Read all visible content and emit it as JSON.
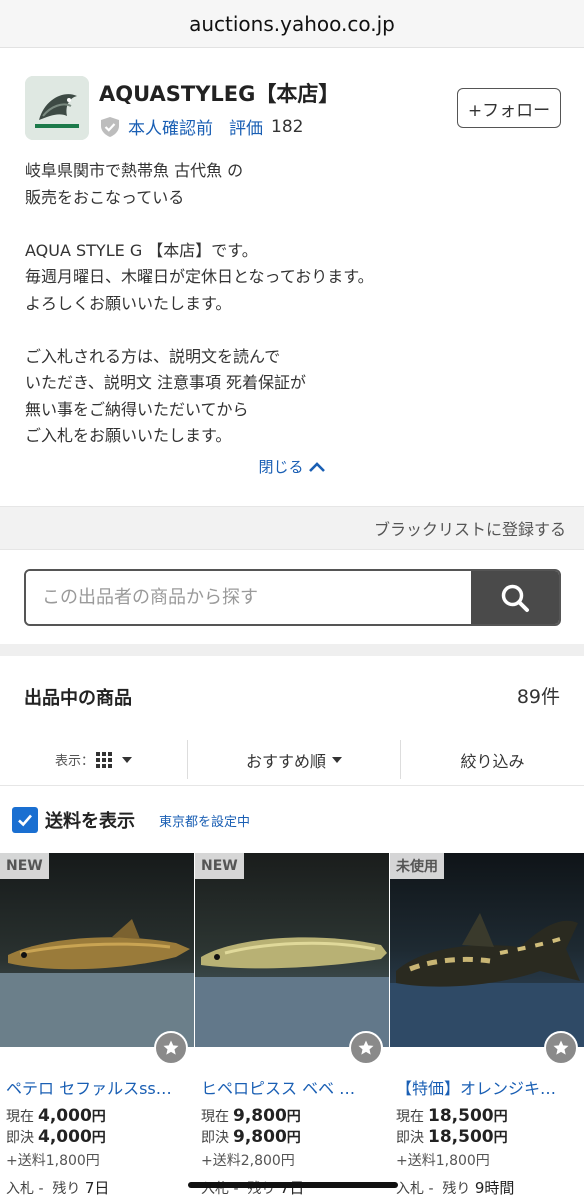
{
  "browser": {
    "url": "auctions.yahoo.co.jp"
  },
  "seller": {
    "name": "AQUASTYLEG【本店】",
    "verified": "本人確認前",
    "rating_label": "評価",
    "rating_value": "182",
    "follow_label": "+フォロー",
    "description_lines": [
      "岐阜県関市で熱帯魚 古代魚 の",
      "販売をおこなっている",
      "",
      "AQUA STYLE G 【本店】です。",
      "毎週月曜日、木曜日が定休日となっております。",
      "よろしくお願いいたします。",
      "",
      "ご入札される方は、説明文を読んで",
      "いただき、説明文 注意事項 死着保証が",
      "無い事をご納得いただいてから",
      "ご入札をお願いいたします。"
    ],
    "close_label": "閉じる"
  },
  "blacklist_label": "ブラックリストに登録する",
  "search": {
    "placeholder": "この出品者の商品から探す"
  },
  "listing": {
    "title": "出品中の商品",
    "count": "89件",
    "view_label": "表示：",
    "sort_label": "おすすめ順",
    "filter_label": "絞り込み"
  },
  "shipping": {
    "label": "送料を表示",
    "location": "東京都を設定中"
  },
  "products": [
    {
      "badge": "NEW",
      "title": "ペテロ セファルスss…",
      "current_label": "現在",
      "current": "4,000",
      "buyout_label": "即決",
      "buyout": "4,000",
      "unit": "円",
      "shipping": "+送料1,800円",
      "bids": "入札 -",
      "remaining_label": "残り",
      "remaining": "7日"
    },
    {
      "badge": "NEW",
      "title": "ヒペロピスス ベベ …",
      "current_label": "現在",
      "current": "9,800",
      "buyout_label": "即決",
      "buyout": "9,800",
      "unit": "円",
      "shipping": "+送料2,800円",
      "bids": "入札 -",
      "remaining_label": "残り",
      "remaining": "7日"
    },
    {
      "badge": "未使用",
      "title": "【特価】オレンジキ…",
      "current_label": "現在",
      "current": "18,500",
      "buyout_label": "即決",
      "buyout": "18,500",
      "unit": "円",
      "shipping": "+送料1,800円",
      "bids": "入札 -",
      "remaining_label": "残り",
      "remaining": "9時間"
    }
  ]
}
